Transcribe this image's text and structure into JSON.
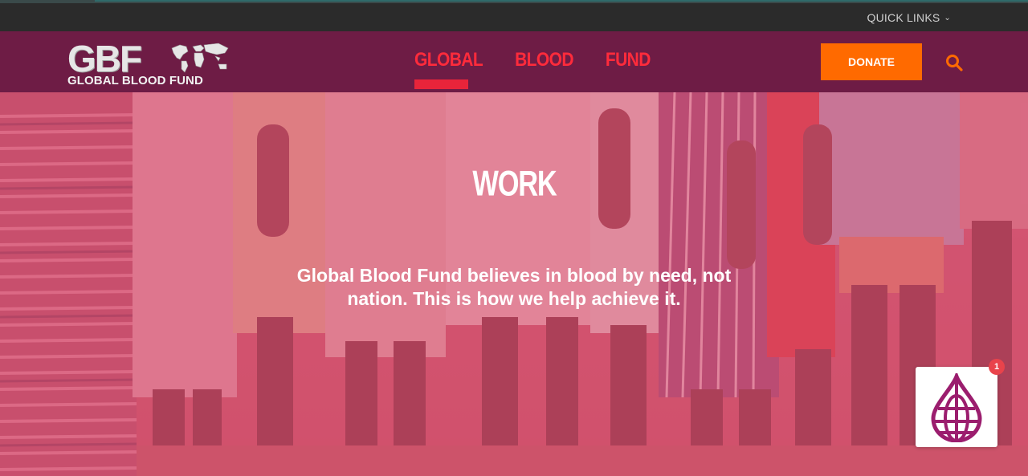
{
  "topbar": {
    "quick_links_label": "QUICK LINKS"
  },
  "header": {
    "logo": {
      "wordmark": "GBF",
      "subtitle": "GLOBAL BLOOD FUND"
    },
    "nav": [
      {
        "label": "GLOBAL",
        "active": true
      },
      {
        "label": "BLOOD",
        "active": false
      },
      {
        "label": "FUND",
        "active": false
      }
    ],
    "donate_label": "DONATE"
  },
  "hero": {
    "title": "WORK",
    "text": "Global Blood Fund believes in blood by need, not nation. This is how we help achieve it."
  },
  "widget": {
    "badge_count": "1",
    "icon": "blood-drop-globe-icon"
  },
  "colors": {
    "header_bg": "#6e1c45",
    "nav_accent": "#ff2b3b",
    "donate_bg": "#ff6a00",
    "hero_tint": "#d64e70",
    "widget_icon": "#9b1d6e"
  }
}
